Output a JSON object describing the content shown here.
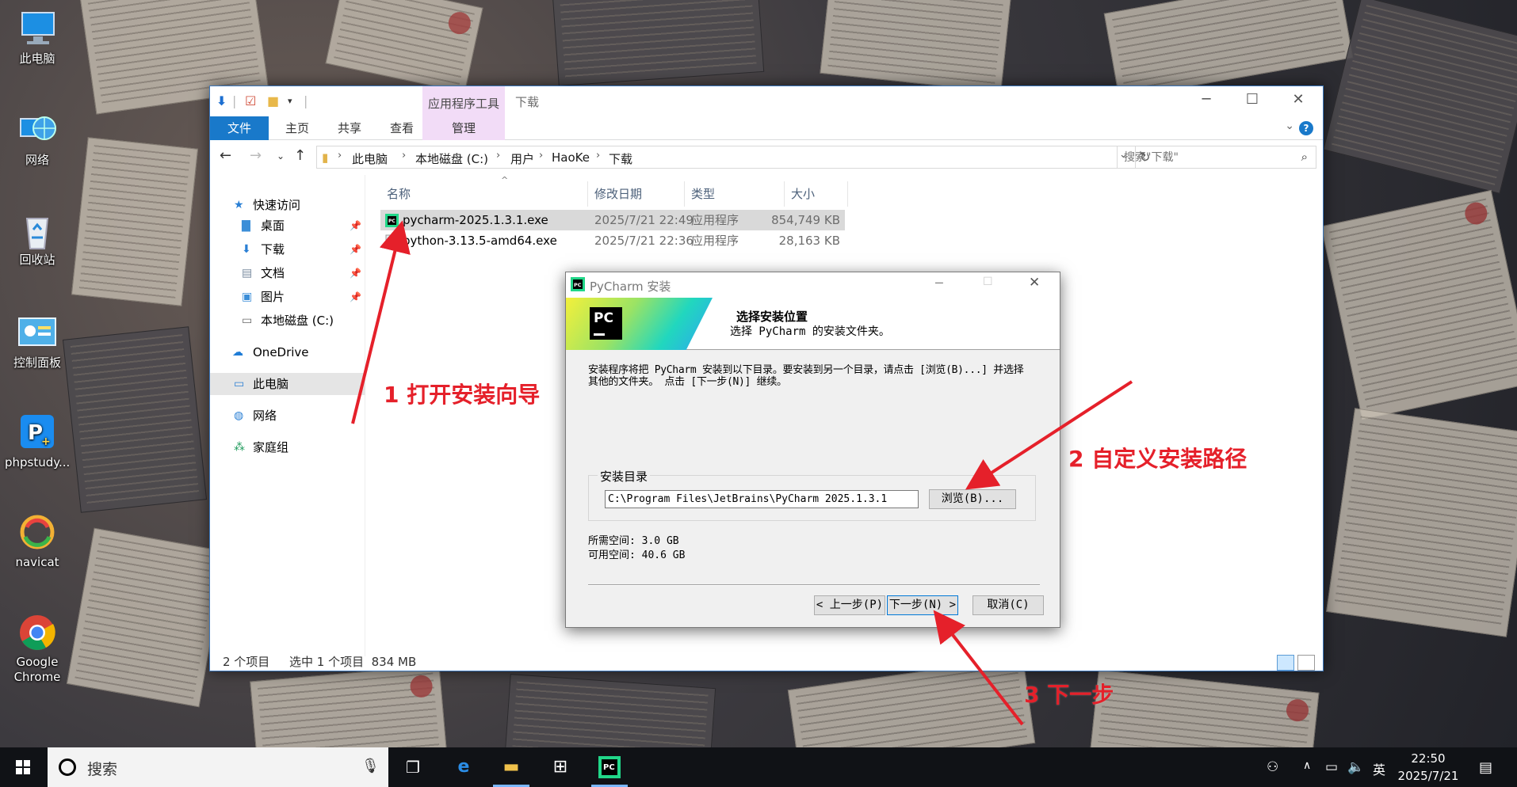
{
  "desktop": {
    "icons": [
      {
        "label": "此电脑",
        "icon": "computer-icon"
      },
      {
        "label": "网络",
        "icon": "network-globe-icon"
      },
      {
        "label": "回收站",
        "icon": "recycle-bin-icon"
      },
      {
        "label": "控制面板",
        "icon": "control-panel-icon"
      },
      {
        "label": "phpstudy...",
        "icon": "phpstudy-icon"
      },
      {
        "label": "navicat",
        "icon": "navicat-icon"
      },
      {
        "label": "Google Chrome",
        "icon": "chrome-icon"
      }
    ]
  },
  "explorer": {
    "title": "下载",
    "contextual_tab_group": "应用程序工具",
    "ribbon_tabs": [
      "文件",
      "主页",
      "共享",
      "查看",
      "管理"
    ],
    "breadcrumb": [
      "此电脑",
      "本地磁盘 (C:)",
      "用户",
      "HaoKe",
      "下载"
    ],
    "search_placeholder": "搜索\"下载\"",
    "nav": {
      "quick_access": "快速访问",
      "pinned": [
        "桌面",
        "下载",
        "文档",
        "图片"
      ],
      "local_disk": "本地磁盘 (C:)",
      "onedrive": "OneDrive",
      "this_pc": "此电脑",
      "network": "网络",
      "homegroup": "家庭组"
    },
    "columns": [
      "名称",
      "修改日期",
      "类型",
      "大小"
    ],
    "files": [
      {
        "name": "pycharm-2025.1.3.1.exe",
        "modified": "2025/7/21 22:49",
        "type": "应用程序",
        "size": "854,749 KB",
        "selected": true
      },
      {
        "name": "python-3.13.5-amd64.exe",
        "modified": "2025/7/21 22:36",
        "type": "应用程序",
        "size": "28,163 KB",
        "selected": false
      }
    ],
    "status": {
      "count": "2 个项目",
      "selection": "选中 1 个项目  834 MB"
    }
  },
  "installer": {
    "window_title": "PyCharm 安装",
    "logo_text": "PC",
    "heading": "选择安装位置",
    "subheading": "选择 PyCharm 的安装文件夹。",
    "description": "安装程序将把 PyCharm 安装到以下目录。要安装到另一个目录，请点击 [浏览(B)...] 并选择其他的文件夹。 点击 [下一步(N)] 继续。",
    "dest_group_label": "安装目录",
    "dest_path": "C:\\Program Files\\JetBrains\\PyCharm 2025.1.3.1",
    "browse_label": "浏览(B)...",
    "space_required": "所需空间: 3.0 GB",
    "space_available": "可用空间: 40.6 GB",
    "back_label": "< 上一步(P)",
    "next_label": "下一步(N) >",
    "cancel_label": "取消(C)"
  },
  "annotations": {
    "step1": "1 打开安装向导",
    "step2": "2 自定义安装路径",
    "step3": "3 下一步",
    "color": "#e5202a"
  },
  "taskbar": {
    "search_text": "搜索",
    "apps": [
      "task-view-icon",
      "edge-icon",
      "file-explorer-icon",
      "store-icon",
      "pycharm-icon"
    ],
    "ime": "英",
    "time": "22:50",
    "date": "2025/7/21"
  },
  "colors": {
    "accent": "#1979ca",
    "selection": "#d9d9d9",
    "contextual_tab": "#f2dcf7"
  }
}
